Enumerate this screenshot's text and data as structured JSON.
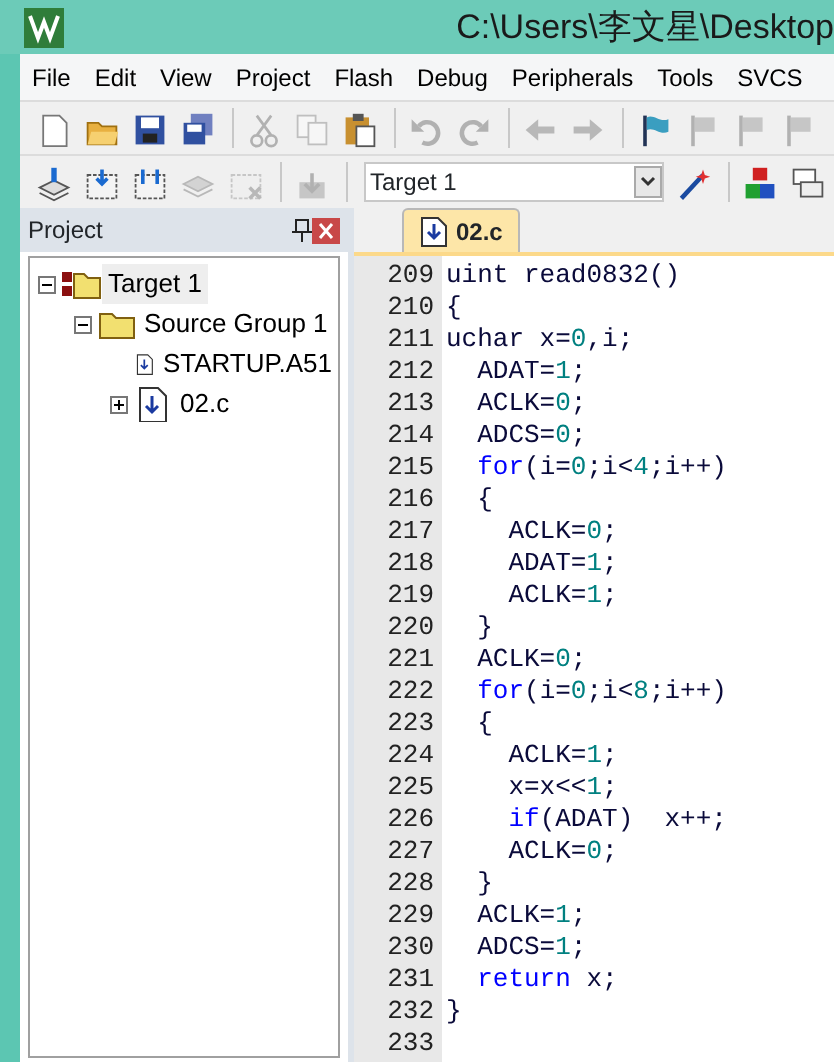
{
  "window": {
    "title": "C:\\Users\\李文星\\Desktop"
  },
  "menu": [
    "File",
    "Edit",
    "View",
    "Project",
    "Flash",
    "Debug",
    "Peripherals",
    "Tools",
    "SVCS"
  ],
  "toolbar_1": [
    {
      "kind": "new",
      "disabled": false
    },
    {
      "kind": "open",
      "disabled": false
    },
    {
      "kind": "save",
      "disabled": false
    },
    {
      "kind": "saveall",
      "disabled": false
    },
    {
      "kind": "sep"
    },
    {
      "kind": "cut",
      "disabled": true
    },
    {
      "kind": "copy",
      "disabled": true
    },
    {
      "kind": "paste",
      "disabled": false
    },
    {
      "kind": "sep"
    },
    {
      "kind": "undo",
      "disabled": true
    },
    {
      "kind": "redo",
      "disabled": true
    },
    {
      "kind": "sep"
    },
    {
      "kind": "back",
      "disabled": true
    },
    {
      "kind": "forward",
      "disabled": true
    },
    {
      "kind": "sep"
    },
    {
      "kind": "flag",
      "disabled": false
    },
    {
      "kind": "flagprev",
      "disabled": true
    },
    {
      "kind": "flagnext",
      "disabled": true
    },
    {
      "kind": "flagclear",
      "disabled": true
    }
  ],
  "toolbar_2": [
    {
      "kind": "translate",
      "disabled": false
    },
    {
      "kind": "build",
      "disabled": false
    },
    {
      "kind": "rebuild",
      "disabled": false
    },
    {
      "kind": "batch",
      "disabled": true
    },
    {
      "kind": "stop",
      "disabled": true
    },
    {
      "kind": "sep"
    },
    {
      "kind": "load",
      "disabled": true
    },
    {
      "kind": "sep"
    },
    {
      "kind": "target"
    },
    {
      "kind": "wand",
      "disabled": false
    },
    {
      "kind": "sep"
    },
    {
      "kind": "blocks",
      "disabled": false
    },
    {
      "kind": "windows",
      "disabled": false
    }
  ],
  "target_select": {
    "value": "Target 1"
  },
  "project_panel": {
    "title": "Project",
    "tree": [
      {
        "label": "Target 1",
        "kind": "target",
        "selected": true,
        "expanded": true,
        "children": [
          {
            "label": "Source Group 1",
            "kind": "group",
            "selected": false,
            "expanded": true,
            "children": [
              {
                "label": "STARTUP.A51",
                "kind": "file",
                "selected": false
              },
              {
                "label": "02.c",
                "kind": "file",
                "selected": false,
                "expanded": false
              }
            ]
          }
        ]
      }
    ]
  },
  "editor": {
    "tabs": [
      {
        "label": "02.c",
        "selected": true
      }
    ],
    "lines": [
      {
        "number": "209",
        "tokens": [
          {
            "kind": "plain",
            "text": "uint read0832()"
          }
        ]
      },
      {
        "number": "210",
        "tokens": [
          {
            "kind": "plain",
            "text": "{"
          }
        ]
      },
      {
        "number": "211",
        "tokens": [
          {
            "kind": "plain",
            "text": "uchar x="
          },
          {
            "kind": "number",
            "text": "0"
          },
          {
            "kind": "plain",
            "text": ",i;"
          }
        ]
      },
      {
        "number": "212",
        "tokens": [
          {
            "kind": "plain",
            "text": "  ADAT="
          },
          {
            "kind": "number",
            "text": "1"
          },
          {
            "kind": "plain",
            "text": ";"
          }
        ]
      },
      {
        "number": "213",
        "tokens": [
          {
            "kind": "plain",
            "text": "  ACLK="
          },
          {
            "kind": "number",
            "text": "0"
          },
          {
            "kind": "plain",
            "text": ";"
          }
        ]
      },
      {
        "number": "214",
        "tokens": [
          {
            "kind": "plain",
            "text": "  ADCS="
          },
          {
            "kind": "number",
            "text": "0"
          },
          {
            "kind": "plain",
            "text": ";"
          }
        ]
      },
      {
        "number": "215",
        "tokens": [
          {
            "kind": "keyword",
            "text": "  for"
          },
          {
            "kind": "plain",
            "text": "(i="
          },
          {
            "kind": "number",
            "text": "0"
          },
          {
            "kind": "plain",
            "text": ";i<"
          },
          {
            "kind": "number",
            "text": "4"
          },
          {
            "kind": "plain",
            "text": ";i++)"
          }
        ]
      },
      {
        "number": "216",
        "tokens": [
          {
            "kind": "plain",
            "text": "  {"
          }
        ]
      },
      {
        "number": "217",
        "tokens": [
          {
            "kind": "plain",
            "text": "    ACLK="
          },
          {
            "kind": "number",
            "text": "0"
          },
          {
            "kind": "plain",
            "text": ";"
          }
        ]
      },
      {
        "number": "218",
        "tokens": [
          {
            "kind": "plain",
            "text": "    ADAT="
          },
          {
            "kind": "number",
            "text": "1"
          },
          {
            "kind": "plain",
            "text": ";"
          }
        ]
      },
      {
        "number": "219",
        "tokens": [
          {
            "kind": "plain",
            "text": "    ACLK="
          },
          {
            "kind": "number",
            "text": "1"
          },
          {
            "kind": "plain",
            "text": ";"
          }
        ]
      },
      {
        "number": "220",
        "tokens": [
          {
            "kind": "plain",
            "text": "  }"
          }
        ]
      },
      {
        "number": "221",
        "tokens": [
          {
            "kind": "plain",
            "text": "  ACLK="
          },
          {
            "kind": "number",
            "text": "0"
          },
          {
            "kind": "plain",
            "text": ";"
          }
        ]
      },
      {
        "number": "222",
        "tokens": [
          {
            "kind": "keyword",
            "text": "  for"
          },
          {
            "kind": "plain",
            "text": "(i="
          },
          {
            "kind": "number",
            "text": "0"
          },
          {
            "kind": "plain",
            "text": ";i<"
          },
          {
            "kind": "number",
            "text": "8"
          },
          {
            "kind": "plain",
            "text": ";i++)"
          }
        ]
      },
      {
        "number": "223",
        "tokens": [
          {
            "kind": "plain",
            "text": "  {"
          }
        ]
      },
      {
        "number": "224",
        "tokens": [
          {
            "kind": "plain",
            "text": "    ACLK="
          },
          {
            "kind": "number",
            "text": "1"
          },
          {
            "kind": "plain",
            "text": ";"
          }
        ]
      },
      {
        "number": "225",
        "tokens": [
          {
            "kind": "plain",
            "text": "    x=x<<"
          },
          {
            "kind": "number",
            "text": "1"
          },
          {
            "kind": "plain",
            "text": ";"
          }
        ]
      },
      {
        "number": "226",
        "tokens": [
          {
            "kind": "keyword",
            "text": "    if"
          },
          {
            "kind": "plain",
            "text": "(ADAT)  x++;"
          }
        ]
      },
      {
        "number": "227",
        "tokens": [
          {
            "kind": "plain",
            "text": "    ACLK="
          },
          {
            "kind": "number",
            "text": "0"
          },
          {
            "kind": "plain",
            "text": ";"
          }
        ]
      },
      {
        "number": "228",
        "tokens": [
          {
            "kind": "plain",
            "text": "  }"
          }
        ]
      },
      {
        "number": "229",
        "tokens": [
          {
            "kind": "plain",
            "text": "  ACLK="
          },
          {
            "kind": "number",
            "text": "1"
          },
          {
            "kind": "plain",
            "text": ";"
          }
        ]
      },
      {
        "number": "230",
        "tokens": [
          {
            "kind": "plain",
            "text": "  ADCS="
          },
          {
            "kind": "number",
            "text": "1"
          },
          {
            "kind": "plain",
            "text": ";"
          }
        ]
      },
      {
        "number": "231",
        "tokens": [
          {
            "kind": "keyword",
            "text": "  return"
          },
          {
            "kind": "plain",
            "text": " x;"
          }
        ]
      },
      {
        "number": "232",
        "tokens": [
          {
            "kind": "plain",
            "text": "}"
          }
        ]
      },
      {
        "number": "233"
      }
    ]
  }
}
